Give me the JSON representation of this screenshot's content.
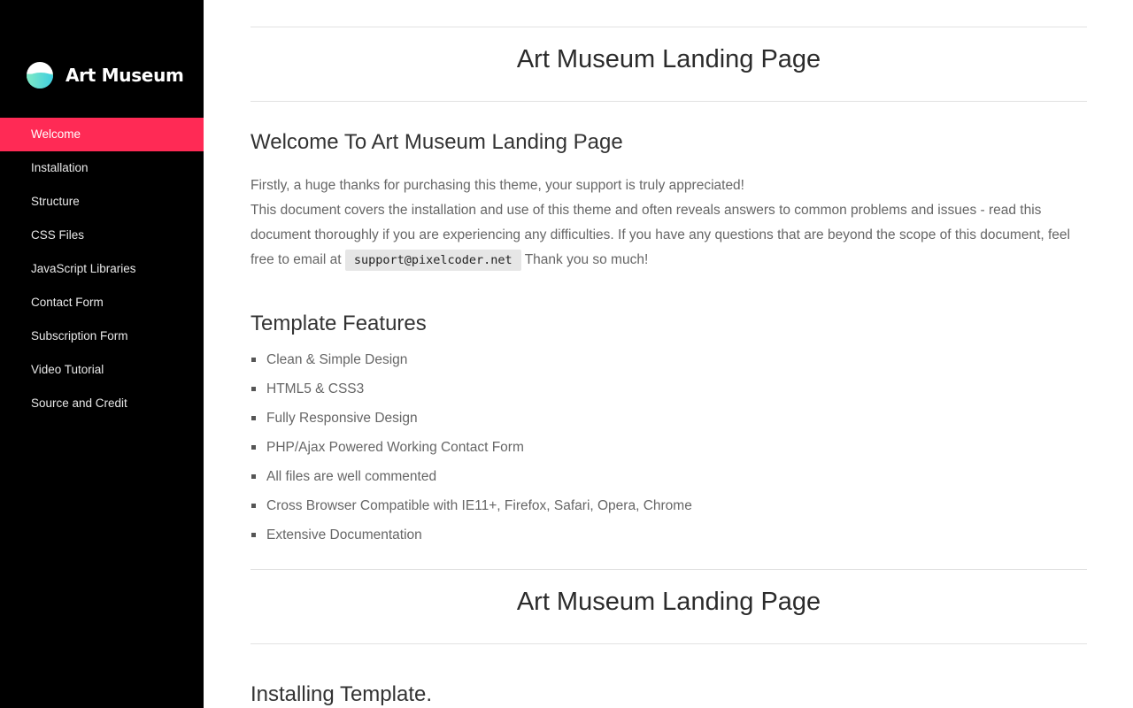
{
  "brand": {
    "name": "Art Museum",
    "logo_icon": "art-museum-logo-icon"
  },
  "colors": {
    "sidebar_bg": "#000000",
    "accent": "#ff2a55",
    "code_bg": "#e6e6e6"
  },
  "nav": {
    "items": [
      {
        "label": "Welcome",
        "active": true
      },
      {
        "label": "Installation",
        "active": false
      },
      {
        "label": "Structure",
        "active": false
      },
      {
        "label": "CSS Files",
        "active": false
      },
      {
        "label": "JavaScript Libraries",
        "active": false
      },
      {
        "label": "Contact Form",
        "active": false
      },
      {
        "label": "Subscription Form",
        "active": false
      },
      {
        "label": "Video Tutorial",
        "active": false
      },
      {
        "label": "Source and Credit",
        "active": false
      }
    ]
  },
  "main": {
    "page_heading_1": "Art Museum Landing Page",
    "welcome": {
      "title": "Welcome To Art Museum Landing Page",
      "line1": "Firstly, a huge thanks for purchasing this theme, your support is truly appreciated!",
      "line2": "This document covers the installation and use of this theme and often reveals answers to common problems and issues - read this document thoroughly if you are experiencing any difficulties. If you have any questions that are beyond the scope of this document, feel free to email at",
      "email": "support@pixelcoder.net",
      "line3": "Thank you so much!"
    },
    "features": {
      "title": "Template Features",
      "items": [
        "Clean & Simple Design",
        "HTML5 & CSS3",
        "Fully Responsive Design",
        "PHP/Ajax Powered Working Contact Form",
        "All files are well commented",
        "Cross Browser Compatible with IE11+, Firefox, Safari, Opera, Chrome",
        "Extensive Documentation"
      ]
    },
    "page_heading_2": "Art Museum Landing Page",
    "installing": {
      "title": "Installing Template."
    }
  }
}
